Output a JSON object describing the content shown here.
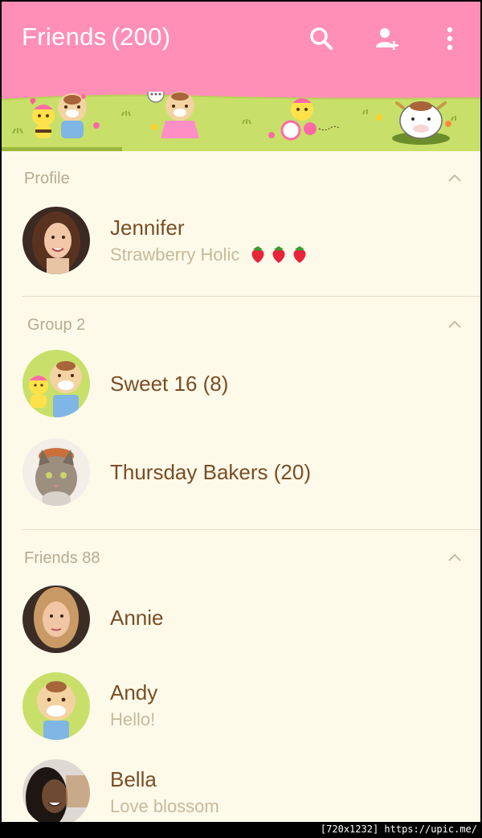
{
  "header": {
    "title": "Friends",
    "count": "(200)",
    "colors": {
      "bar": "#ff8fb6",
      "grass": "#c8e06a"
    }
  },
  "sections": [
    {
      "label": "Profile"
    },
    {
      "label": "Group 2"
    },
    {
      "label": "Friends 88"
    }
  ],
  "profile": {
    "name": "Jennifer",
    "status": "Strawberry Holic"
  },
  "groups": [
    {
      "name": "Sweet 16 (8)"
    },
    {
      "name": "Thursday Bakers (20)"
    }
  ],
  "friends": [
    {
      "name": "Annie",
      "status": ""
    },
    {
      "name": "Andy",
      "status": "Hello!"
    },
    {
      "name": "Bella",
      "status": "Love blossom"
    }
  ],
  "icons": {
    "search": "search-icon",
    "add_friend": "add-friend-icon",
    "overflow": "more-vert-icon",
    "collapse": "chevron-up-icon",
    "strawberry": "strawberry-icon"
  },
  "watermark": "[720x1232] https://upic.me/"
}
